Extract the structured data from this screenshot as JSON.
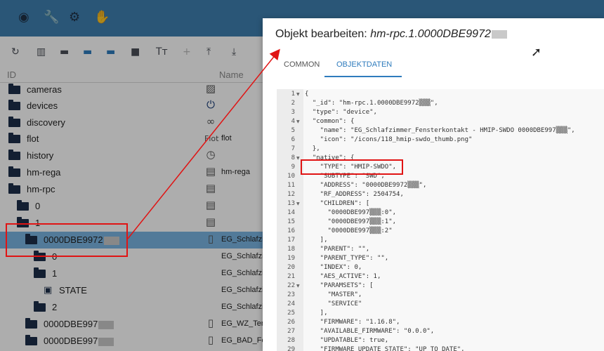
{
  "topbar": {
    "icons": [
      "eye-icon",
      "wrench-icon",
      "gear-icon",
      "hand-icon"
    ]
  },
  "toolbar": {
    "icons": [
      "refresh-icon",
      "columns-icon",
      "folder-icon",
      "folder-open-icon",
      "folder-icon",
      "badge-1-icon",
      "text-size-icon",
      "add-icon",
      "upload-icon",
      "download-icon"
    ]
  },
  "columns": {
    "id": "ID",
    "name": "Name"
  },
  "tree": [
    {
      "id": "cameras",
      "icon": "image-icon",
      "name": ""
    },
    {
      "id": "devices",
      "icon": "power-icon",
      "name": ""
    },
    {
      "id": "discovery",
      "icon": "binoculars-icon",
      "name": ""
    },
    {
      "id": "flot",
      "icon": "flot-icon",
      "icon_text": "Flot",
      "name": "flot"
    },
    {
      "id": "history",
      "icon": "clock-icon",
      "name": ""
    },
    {
      "id": "hm-rega",
      "icon": "doc-icon",
      "name": "hm-rega"
    },
    {
      "id": "hm-rpc",
      "icon": "doc-icon",
      "name": ""
    },
    {
      "id": "0",
      "icon": "doc-icon",
      "name": ""
    },
    {
      "id": "1",
      "icon": "doc-icon",
      "name": ""
    },
    {
      "id": "0000DBE9972",
      "icon": "doc-icon",
      "name": "EG_Schlafzim"
    },
    {
      "id": "0",
      "icon": "",
      "name": "EG_Schlafzimm"
    },
    {
      "id": "1",
      "icon": "",
      "name": "EG_Schlafzimm"
    },
    {
      "id": "STATE",
      "icon": "",
      "name": "EG_Schlafzimm"
    },
    {
      "id": "2",
      "icon": "",
      "name": "EG_Schlafzimm"
    },
    {
      "id": "0000DBE997",
      "icon": "door-icon",
      "name": "EG_WZ_Terra"
    },
    {
      "id": "0000DBE997",
      "icon": "door-icon",
      "name": "EG_BAD_Fen"
    }
  ],
  "dialog": {
    "title_prefix": "Objekt bearbeiten: ",
    "title_id": "hm-rpc.1.0000DBE9972",
    "tabs": [
      "COMMON",
      "OBJEKTDATEN"
    ],
    "active_tab": "OBJEKTDATEN",
    "code_lines": [
      "{",
      "  \"_id\": \"hm-rpc.1.0000DBE9972▒▒▒\",",
      "  \"type\": \"device\",",
      "  \"common\": {",
      "    \"name\": \"EG_Schlafzimmer_Fensterkontakt - HMIP-SWDO 0000DBE997▒▒▒\",",
      "    \"icon\": \"/icons/118_hmip-swdo_thumb.png\"",
      "  },",
      "  \"native\": {",
      "    \"TYPE\": \"HMIP-SWDO\",",
      "    \"SUBTYPE\": \"SWD\",",
      "    \"ADDRESS\": \"0000DBE9972▒▒▒\",",
      "    \"RF_ADDRESS\": 2504754,",
      "    \"CHILDREN\": [",
      "      \"0000DBE997▒▒▒:0\",",
      "      \"0000DBE997▒▒▒:1\",",
      "      \"0000DBE997▒▒▒:2\"",
      "    ],",
      "    \"PARENT\": \"\",",
      "    \"PARENT_TYPE\": \"\",",
      "    \"INDEX\": 0,",
      "    \"AES_ACTIVE\": 1,",
      "    \"PARAMSETS\": [",
      "      \"MASTER\",",
      "      \"SERVICE\"",
      "    ],",
      "    \"FIRMWARE\": \"1.16.8\",",
      "    \"AVAILABLE_FIRMWARE\": \"0.0.0\",",
      "    \"UPDATABLE\": true,",
      "    \"FIRMWARE_UPDATE_STATE\": \"UP_TO_DATE\","
    ]
  }
}
